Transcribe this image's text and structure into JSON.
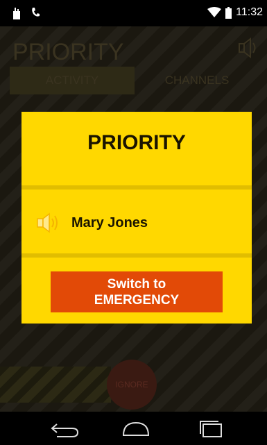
{
  "status_bar": {
    "time": "11:32",
    "left_icons": [
      "notification-icon",
      "phone-icon"
    ],
    "right_icons": [
      "wifi-icon",
      "battery-icon"
    ]
  },
  "app_background": {
    "header_subtitle": "",
    "title": "PRIORITY",
    "tabs": [
      {
        "label": "ACTIVITY"
      },
      {
        "label": "CHANNELS"
      }
    ],
    "bottom_bar": {
      "ignore_label": "IGNORE"
    }
  },
  "dialog": {
    "title": "PRIORITY",
    "caller_name": "Mary Jones",
    "emergency_button_lines": [
      "Switch to",
      "EMERGENCY"
    ]
  },
  "nav_bar": {
    "buttons": [
      "back-icon",
      "home-icon",
      "recents-icon"
    ]
  },
  "colors": {
    "dialog_bg": "#ffd800",
    "divider": "#e1bd00",
    "emergency_button": "#e24a07",
    "text_dark": "#1a1400"
  }
}
